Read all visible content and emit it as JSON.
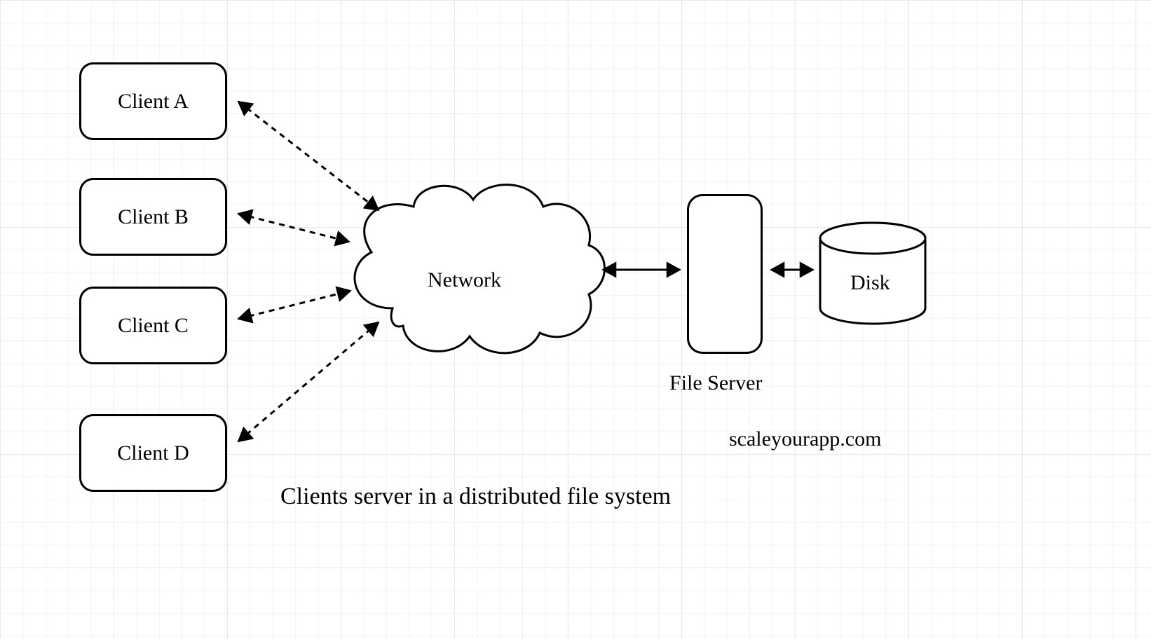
{
  "clients": {
    "a": "Client A",
    "b": "Client B",
    "c": "Client C",
    "d": "Client D"
  },
  "network_label": "Network",
  "file_server_label": "File Server",
  "disk_label": "Disk",
  "caption": "Clients server in a distributed file system",
  "watermark": "scaleyourapp.com"
}
